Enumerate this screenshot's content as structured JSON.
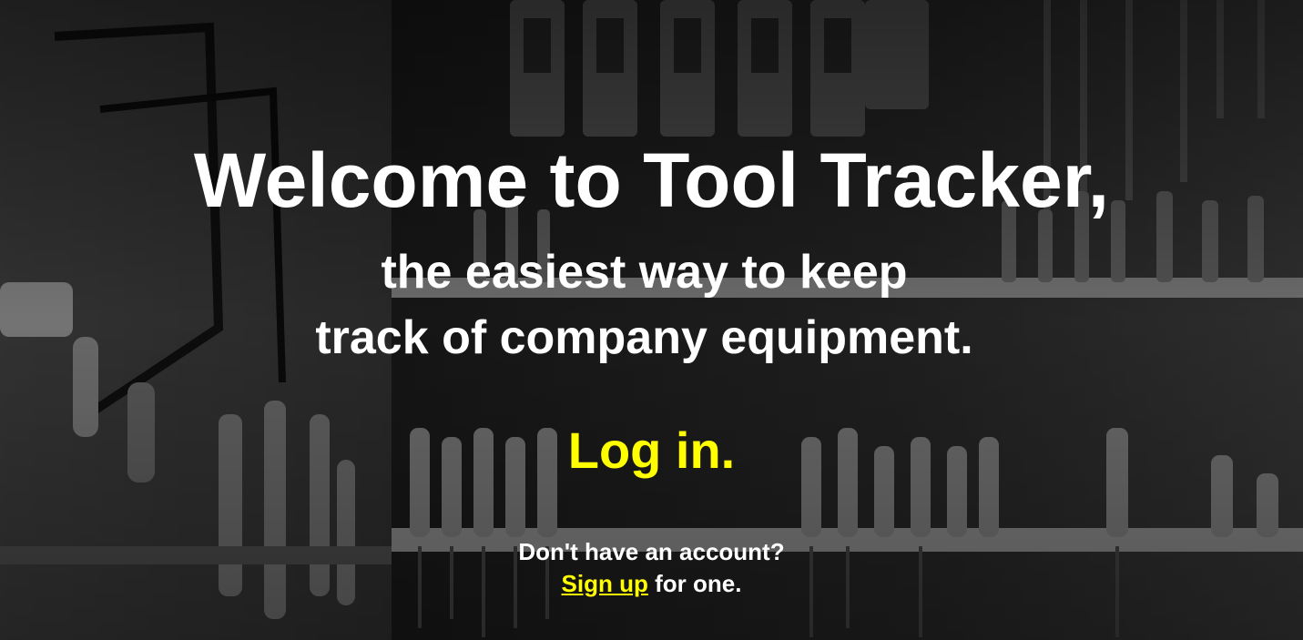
{
  "hero": {
    "title": "Welcome to Tool Tracker,",
    "subtitle_line1": "the easiest way to keep",
    "subtitle_line2": "track of company equipment.",
    "login_label": "Log in.",
    "no_account_text": "Don't have an account?",
    "signup_link_label": "Sign up",
    "signup_suffix": " for one."
  },
  "colors": {
    "accent": "#ffff00",
    "text": "#ffffff",
    "background": "#1f1f1f"
  }
}
